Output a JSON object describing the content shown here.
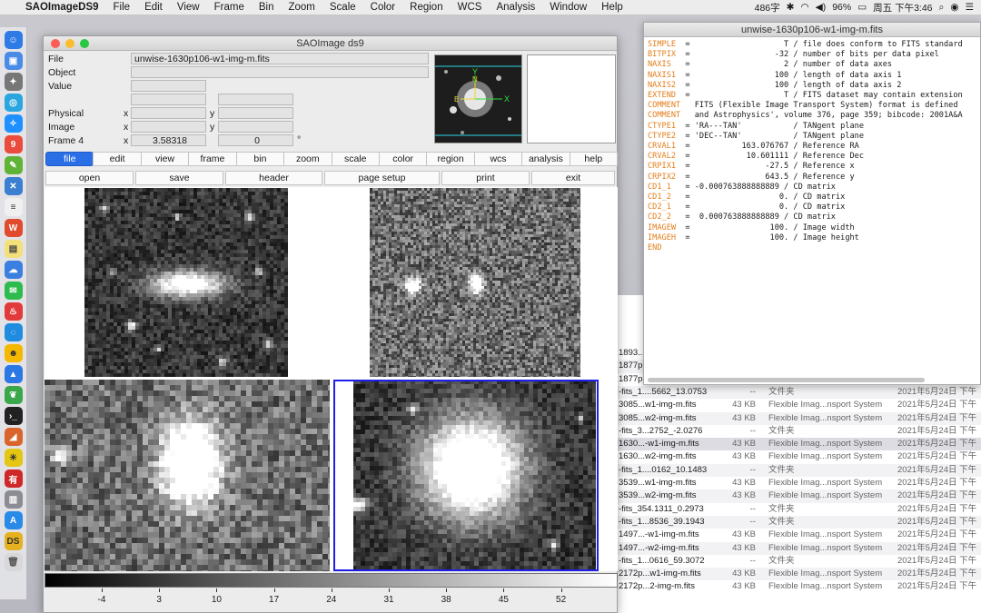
{
  "menubar": {
    "app_name": "SAOImageDS9",
    "items": [
      "File",
      "Edit",
      "View",
      "Frame",
      "Bin",
      "Zoom",
      "Scale",
      "Color",
      "Region",
      "WCS",
      "Analysis",
      "Window",
      "Help"
    ],
    "tray": {
      "speed": "486字",
      "battery": "96%",
      "clock": "周五 下午3:46"
    }
  },
  "ds9": {
    "title": "SAOImage ds9",
    "labels": {
      "file": "File",
      "object": "Object",
      "value": "Value",
      "physical": "Physical",
      "image": "Image",
      "frame": "Frame 4",
      "x": "x",
      "y": "y",
      "degree": "°"
    },
    "file_value": "unwise-1630p106-w1-img-m.fits",
    "frame_x": "3.58318",
    "frame_y": "0",
    "buttons": [
      "file",
      "edit",
      "view",
      "frame",
      "bin",
      "zoom",
      "scale",
      "color",
      "region",
      "wcs",
      "analysis",
      "help"
    ],
    "subbuttons": [
      "open",
      "save",
      "header",
      "page setup",
      "print",
      "exit"
    ],
    "panner_labels": {
      "y": "Y",
      "x": "X",
      "n": "N",
      "e": "E"
    },
    "colorbar_ticks": [
      "-4",
      "3",
      "10",
      "17",
      "24",
      "31",
      "38",
      "45",
      "52"
    ]
  },
  "header_window": {
    "title": "unwise-1630p106-w1-img-m.fits",
    "lines": [
      {
        "key": "SIMPLE  ",
        "val": "=                    T / file does conform to FITS standard"
      },
      {
        "key": "BITPIX  ",
        "val": "=                  -32 / number of bits per data pixel"
      },
      {
        "key": "NAXIS   ",
        "val": "=                    2 / number of data axes"
      },
      {
        "key": "NAXIS1  ",
        "val": "=                  100 / length of data axis 1"
      },
      {
        "key": "NAXIS2  ",
        "val": "=                  100 / length of data axis 2"
      },
      {
        "key": "EXTEND  ",
        "val": "=                    T / FITS dataset may contain extension"
      },
      {
        "key": "COMMENT ",
        "val": "  FITS (Flexible Image Transport System) format is defined"
      },
      {
        "key": "COMMENT ",
        "val": "  and Astrophysics', volume 376, page 359; bibcode: 2001A&A"
      },
      {
        "key": "CTYPE1  ",
        "val": "= 'RA---TAN'           / TANgent plane"
      },
      {
        "key": "CTYPE2  ",
        "val": "= 'DEC--TAN'           / TANgent plane"
      },
      {
        "key": "CRVAL1  ",
        "val": "=           163.076767 / Reference RA"
      },
      {
        "key": "CRVAL2  ",
        "val": "=            10.601111 / Reference Dec"
      },
      {
        "key": "CRPIX1  ",
        "val": "=                -27.5 / Reference x"
      },
      {
        "key": "CRPIX2  ",
        "val": "=                643.5 / Reference y"
      },
      {
        "key": "CD1_1   ",
        "val": "= -0.000763888888889 / CD matrix"
      },
      {
        "key": "CD1_2   ",
        "val": "=                   0. / CD matrix"
      },
      {
        "key": "CD2_1   ",
        "val": "=                   0. / CD matrix"
      },
      {
        "key": "CD2_2   ",
        "val": "=  0.000763888888889 / CD matrix"
      },
      {
        "key": "IMAGEW  ",
        "val": "=                 100. / Image width"
      },
      {
        "key": "IMAGEH  ",
        "val": "=                 100. / Image height"
      },
      {
        "key": "END",
        "val": ""
      }
    ]
  },
  "finder": {
    "rows": [
      {
        "name": "1893...",
        "size": "",
        "kind": "",
        "date": ""
      },
      {
        "name": "1877p...",
        "size": "",
        "kind": "",
        "date": ""
      },
      {
        "name": "1877p...",
        "size": "",
        "kind": "",
        "date": ""
      },
      {
        "name": "-fits_1....5662_13.0753",
        "size": "--",
        "kind": "文件夹",
        "date": "2021年5月24日 下午"
      },
      {
        "name": "3085...w1-img-m.fits",
        "size": "43 KB",
        "kind": "Flexible Imag...nsport System",
        "date": "2021年5月24日 下午"
      },
      {
        "name": "3085...w2-img-m.fits",
        "size": "43 KB",
        "kind": "Flexible Imag...nsport System",
        "date": "2021年5月24日 下午"
      },
      {
        "name": "-fits_3...2752_-2.0276",
        "size": "--",
        "kind": "文件夹",
        "date": "2021年5月24日 下午"
      },
      {
        "name": "1630...-w1-img-m.fits",
        "size": "43 KB",
        "kind": "Flexible Imag...nsport System",
        "date": "2021年5月24日 下午"
      },
      {
        "name": "1630...w2-img-m.fits",
        "size": "43 KB",
        "kind": "Flexible Imag...nsport System",
        "date": "2021年5月24日 下午"
      },
      {
        "name": "-fits_1....0162_10.1483",
        "size": "--",
        "kind": "文件夹",
        "date": "2021年5月24日 下午"
      },
      {
        "name": "3539...w1-img-m.fits",
        "size": "43 KB",
        "kind": "Flexible Imag...nsport System",
        "date": "2021年5月24日 下午"
      },
      {
        "name": "3539...w2-img-m.fits",
        "size": "43 KB",
        "kind": "Flexible Imag...nsport System",
        "date": "2021年5月24日 下午"
      },
      {
        "name": "-fits_354.1311_0.2973",
        "size": "--",
        "kind": "文件夹",
        "date": "2021年5月24日 下午"
      },
      {
        "name": "-fits_1...8536_39.1943",
        "size": "--",
        "kind": "文件夹",
        "date": "2021年5月24日 下午"
      },
      {
        "name": "1497...-w1-img-m.fits",
        "size": "43 KB",
        "kind": "Flexible Imag...nsport System",
        "date": "2021年5月24日 下午"
      },
      {
        "name": "1497...-w2-img-m.fits",
        "size": "43 KB",
        "kind": "Flexible Imag...nsport System",
        "date": "2021年5月24日 下午"
      },
      {
        "name": "-fits_1...0616_59.3072",
        "size": "--",
        "kind": "文件夹",
        "date": "2021年5月24日 下午"
      },
      {
        "name": "2172p...w1-img-m.fits",
        "size": "43 KB",
        "kind": "Flexible Imag...nsport System",
        "date": "2021年5月24日 下午"
      },
      {
        "name": "2172p...2-img-m.fits",
        "size": "43 KB",
        "kind": "Flexible Imag...nsport System",
        "date": "2021年5月24日 下午"
      }
    ]
  },
  "colors": {
    "accent": "#2a6fe5",
    "active_frame": "#1e1ee8",
    "header_keyword": "#e37d1a"
  }
}
